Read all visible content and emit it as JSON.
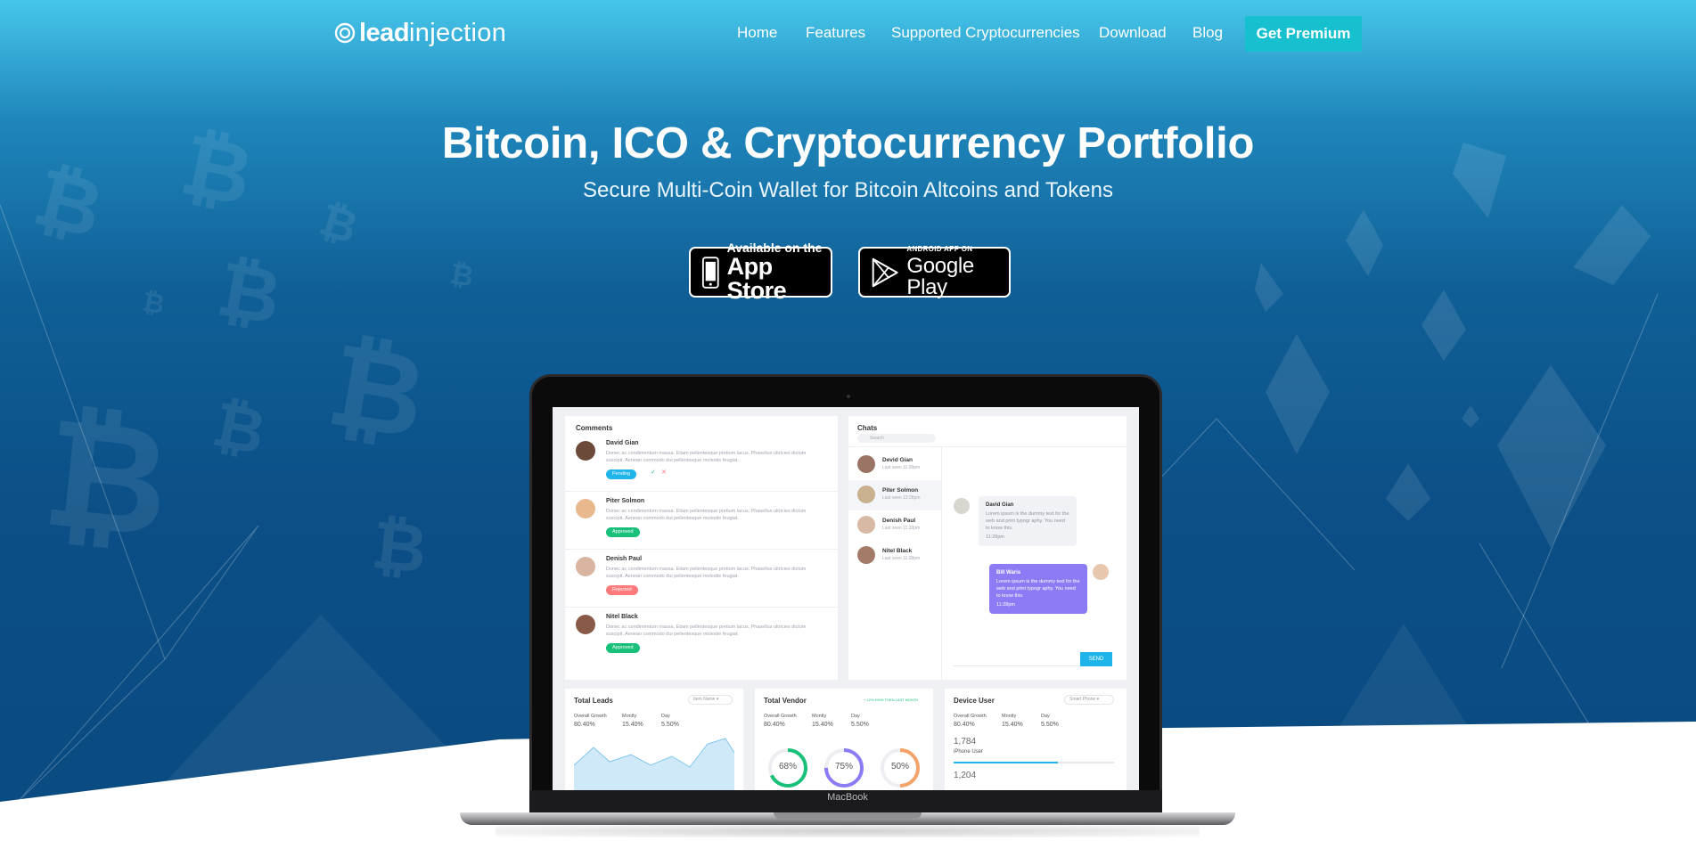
{
  "brand": {
    "logo_bold": "lead",
    "logo_light": "injection"
  },
  "nav": {
    "items": [
      {
        "label": "Home"
      },
      {
        "label": "Features"
      },
      {
        "label": "Supported Cryptocurrencies"
      },
      {
        "label": "Download"
      },
      {
        "label": "Blog"
      }
    ],
    "cta": "Get Premium"
  },
  "hero": {
    "title": "Bitcoin, ICO & Cryptocurrency Portfolio",
    "subtitle": "Secure Multi-Coin Wallet for Bitcoin Altcoins and Tokens"
  },
  "badges": {
    "apple": {
      "small": "Available on the",
      "big": "App Store"
    },
    "google": {
      "small": "ANDROID APP ON",
      "big": "Google Play"
    }
  },
  "laptop": {
    "brand": "MacBook"
  },
  "dashboard": {
    "comments": {
      "title": "Comments",
      "items": [
        {
          "name": "David Gian",
          "text": "Donec ac condimentum massa. Etiam pellentesque pretium lacus. Phasellus ultricies dictum suscipit. Aenean commodo dui pellentesque molestie feugiat.",
          "status": "Pending"
        },
        {
          "name": "Piter Solmon",
          "text": "Donec ac condimentum massa. Etiam pellentesque pretium lacus. Phasellus ultricies dictum suscipit. Aenean commodo dui pellentesque molestie feugiat.",
          "status": "Approved"
        },
        {
          "name": "Denish Paul",
          "text": "Donec ac condimentum massa. Etiam pellentesque pretium lacus. Phasellus ultricies dictum suscipit. Aenean commodo dui pellentesque molestie feugiat.",
          "status": "Rejected"
        },
        {
          "name": "Nitel Black",
          "text": "Donec ac condimentum massa. Etiam pellentesque pretium lacus. Phasellus ultricies dictum suscipit. Aenean commodo dui pellentesque molestie feugiat.",
          "status": "Approved"
        }
      ]
    },
    "chats": {
      "title": "Chats",
      "search_placeholder": "Search",
      "contacts": [
        {
          "name": "Devid Gian",
          "seen": "Last seen 11:28pm"
        },
        {
          "name": "Piter Solmon",
          "seen": "Last seen 12:28pm"
        },
        {
          "name": "Denish Paul",
          "seen": "Last seen 11:28pm"
        },
        {
          "name": "Nitel Black",
          "seen": "Last seen 11:28pm"
        }
      ],
      "msg_in": {
        "name": "David Gian",
        "text": "Lorem ipsum is the dummy text for the web and print typogr aphy. You need to know this.",
        "time": "11:28pm"
      },
      "msg_out": {
        "name": "Bill Waris",
        "text": "Lorem ipsum is the dummy text for the web and print typogr aphy. You need to know this.",
        "time": "11:28pm"
      },
      "send": "SEND"
    },
    "leads": {
      "title": "Total Leads",
      "filter": "Item Name",
      "labels": [
        "Overall Growth",
        "Montly",
        "Day"
      ],
      "values": [
        "80.40%",
        "15.40%",
        "5.50%"
      ]
    },
    "vendor": {
      "title": "Total Vendor",
      "note": "+ 12% HIGH THEN LAST MONTH",
      "labels": [
        "Overall Growth",
        "Montly",
        "Day"
      ],
      "values": [
        "80.40%",
        "15.40%",
        "5.50%"
      ],
      "rings": [
        "68%",
        "75%",
        "50%"
      ],
      "ring_fractions": [
        0.68,
        0.75,
        0.5
      ],
      "ring_colors": [
        "#18c07a",
        "#8b7cf6",
        "#f4a36b"
      ]
    },
    "device": {
      "title": "Device User",
      "filter": "Smart Phone",
      "labels": [
        "Overall Growth",
        "Montly",
        "Day"
      ],
      "values": [
        "80.40%",
        "15.40%",
        "5.50%"
      ],
      "count": "1,784",
      "count_label": "iPhone User",
      "count2": "1,204",
      "bar_fraction": 0.65
    }
  },
  "colors": {
    "cta": "#16c0cf",
    "pending": "#1fb5ea",
    "approved": "#18c07a",
    "rejected": "#ff7a7a",
    "chat_out": "#8b7cf6"
  }
}
